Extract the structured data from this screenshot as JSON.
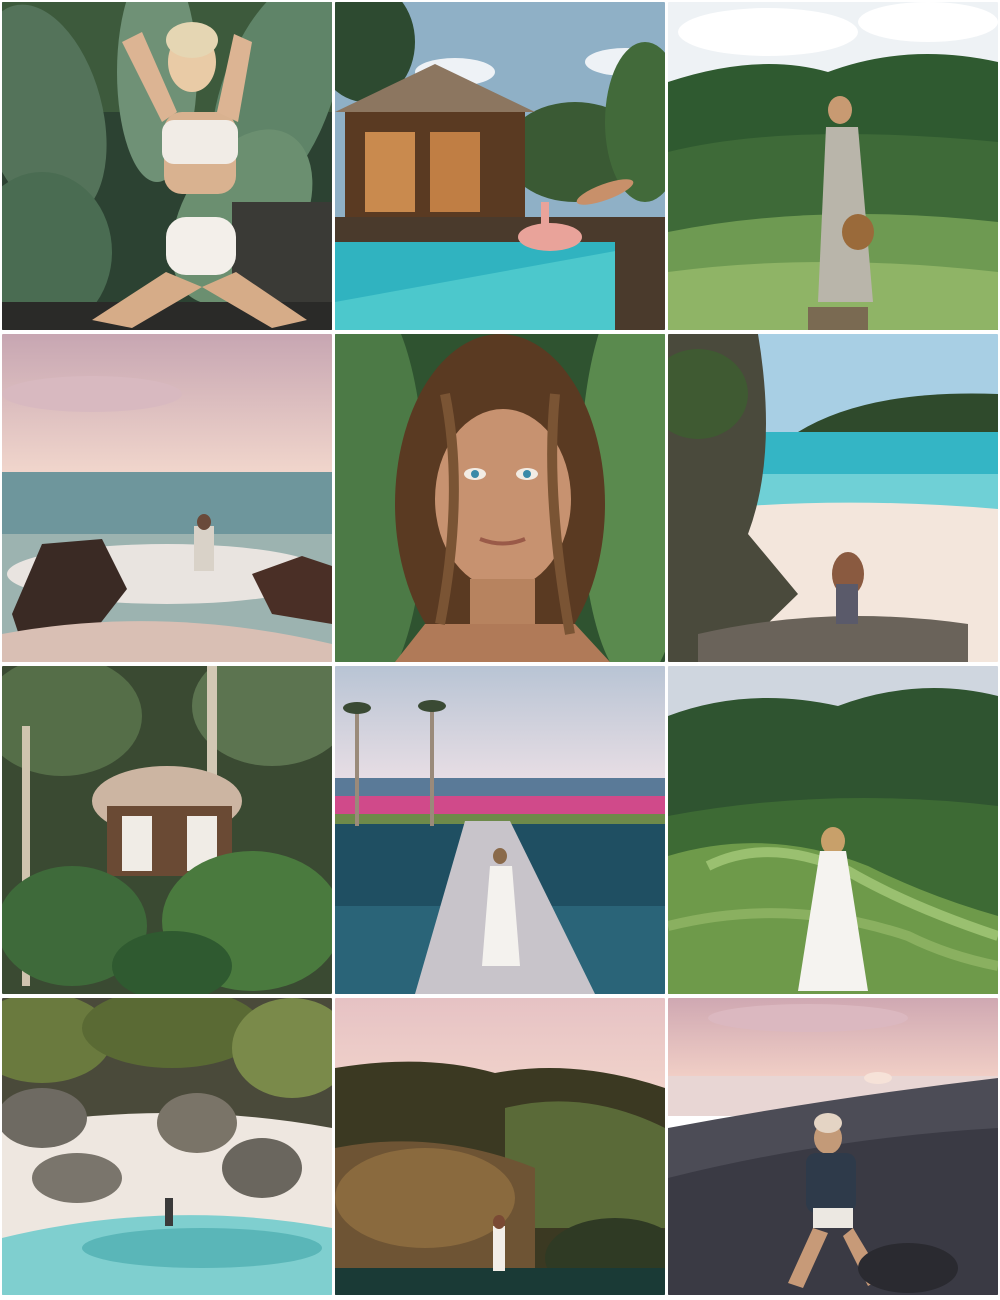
{
  "grid": {
    "columns": 3,
    "rows": 4,
    "tiles": [
      {
        "name": "tropical-leaves-bikini-photo",
        "palette": [
          "#1f3a2a",
          "#6c8a6a",
          "#efe6de"
        ]
      },
      {
        "name": "villa-pool-flamingo-photo",
        "palette": [
          "#8fb0c8",
          "#2fb6c0",
          "#6a4a30"
        ]
      },
      {
        "name": "jungle-valley-woman-photo",
        "palette": [
          "#eef2f6",
          "#2f5a32",
          "#8aa86a"
        ]
      },
      {
        "name": "sunset-ocean-rocks-photo",
        "palette": [
          "#e7c6c0",
          "#6f9aa0",
          "#3a2a26"
        ]
      },
      {
        "name": "portrait-face-leaves-photo",
        "palette": [
          "#2f5530",
          "#b07a58",
          "#5a3a26"
        ]
      },
      {
        "name": "tropical-beach-cove-photo",
        "palette": [
          "#a8d4e8",
          "#39b6c6",
          "#f2e6dc"
        ]
      },
      {
        "name": "aerial-hut-palms-photo",
        "palette": [
          "#2e4a2c",
          "#d7c2b2",
          "#7a9a6a"
        ]
      },
      {
        "name": "infinity-pool-walkway-photo",
        "palette": [
          "#e6dce4",
          "#1f4f62",
          "#c9c6cc"
        ]
      },
      {
        "name": "rice-terrace-white-dress-photo",
        "palette": [
          "#cfd6e0",
          "#3e6a34",
          "#f5f3f0"
        ]
      },
      {
        "name": "white-sand-rocks-lagoon-photo",
        "palette": [
          "#4a4a3a",
          "#efe8e2",
          "#7fcfce"
        ]
      },
      {
        "name": "sunset-jungle-valley-photo",
        "palette": [
          "#f0ccc8",
          "#3c3a24",
          "#8a6a4a"
        ]
      },
      {
        "name": "black-sand-beach-sunset-photo",
        "palette": [
          "#e9c6c6",
          "#4c4c58",
          "#e8dad6"
        ]
      }
    ]
  }
}
